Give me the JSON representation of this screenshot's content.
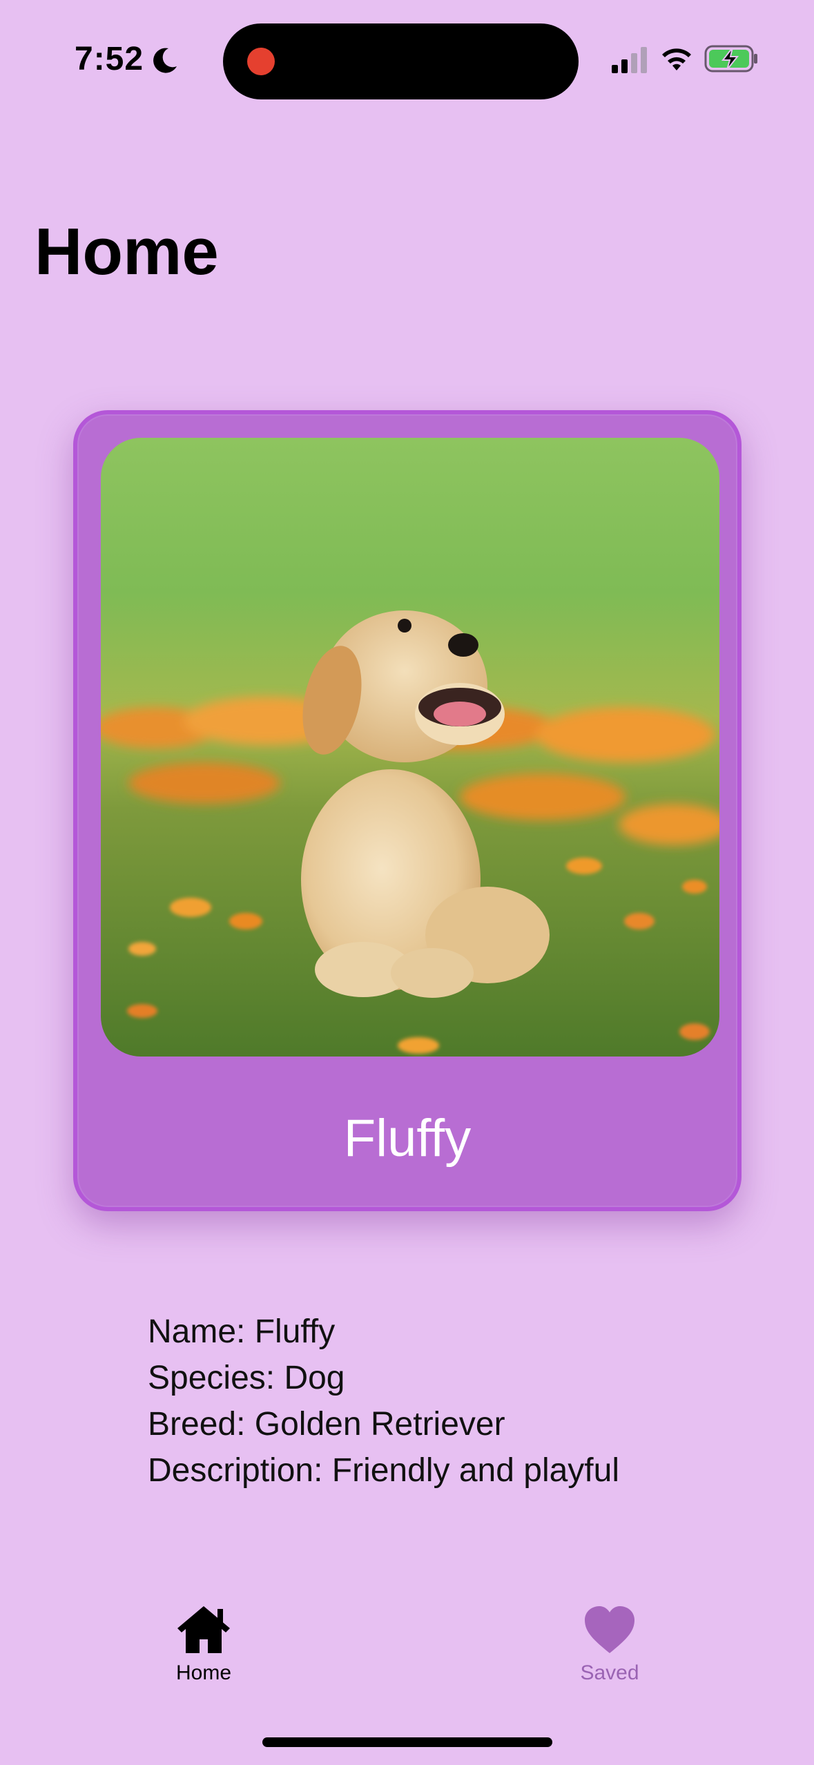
{
  "status_bar": {
    "time": "7:52",
    "icons": [
      "moon-icon",
      "recording-indicator",
      "cellular-signal-icon",
      "wifi-icon",
      "battery-charging-icon"
    ]
  },
  "page": {
    "title": "Home"
  },
  "card": {
    "name": "Fluffy",
    "image": "golden-retriever-puppy-photo",
    "colors": {
      "background": "#e7c0f2",
      "card": "#b86dd3",
      "card_border": "#b457d8"
    }
  },
  "details": {
    "name": "Name: Fluffy",
    "species": "Species: Dog",
    "breed": "Breed: Golden Retriever",
    "description": "Description: Friendly and playful"
  },
  "tab_bar": {
    "tabs": [
      {
        "label": "Home",
        "icon": "house-icon",
        "selected": true
      },
      {
        "label": "Saved",
        "icon": "heart-icon",
        "selected": false
      }
    ],
    "active_color": "#000000",
    "inactive_color": "#9a63b3"
  }
}
